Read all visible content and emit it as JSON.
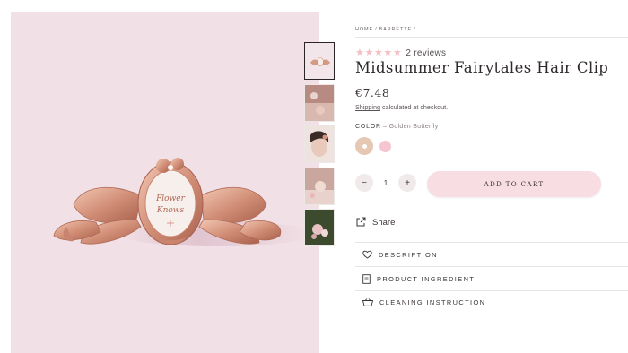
{
  "breadcrumb": [
    "HOME",
    "BARRETTE",
    ""
  ],
  "product": {
    "title": "Midsummer Fairytales Hair Clip",
    "price": "€7.48",
    "shipping_pre": "",
    "shipping_link": "Shipping",
    "shipping_post": " calculated at checkout.",
    "rating": 5,
    "reviews": "2 reviews",
    "image_inscription": [
      "Flower",
      "Knows"
    ]
  },
  "color": {
    "label": "COLOR",
    "separator": " – ",
    "selected": "Golden Butterfly",
    "options": [
      {
        "name": "Golden Butterfly",
        "hex": "#e6c7b4"
      },
      {
        "name": "Pink",
        "hex": "#f5c6d0"
      }
    ]
  },
  "quantity": {
    "value": "1",
    "minus": "−",
    "plus": "+"
  },
  "add_to_cart": "ADD TO CART",
  "share": "Share",
  "accordion": [
    {
      "label": "DESCRIPTION",
      "icon": "heart-icon"
    },
    {
      "label": "PRODUCT INGREDIENT",
      "icon": "document-icon"
    },
    {
      "label": "CLEANING INSTRUCTION",
      "icon": "basket-icon"
    }
  ],
  "colors": {
    "accent": "#f8dde3",
    "star": "#f3bfc4",
    "image_bg": "#f1e1e6"
  }
}
